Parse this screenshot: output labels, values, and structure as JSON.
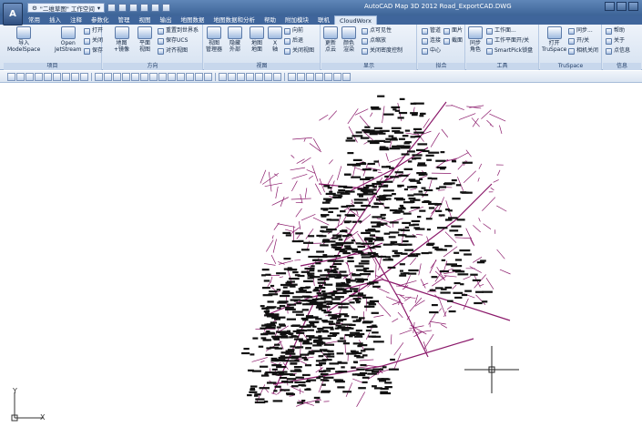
{
  "window": {
    "title": "AutoCAD Map 3D 2012    Road_ExportCAD.DWG",
    "workspace": "\"二维草图\" 工作空间"
  },
  "tabs": [
    "常用",
    "插入",
    "注释",
    "参数化",
    "管理",
    "视图",
    "输出",
    "地图数据",
    "地图数据和分析",
    "帮助",
    "附加模块",
    "联机",
    "CloudWorx"
  ],
  "active_tab": "CloudWorx",
  "ribbon": {
    "project": {
      "title": "项目",
      "import_label": "导入\nModelSpace",
      "import_line1": "导入",
      "import_line2": "ModelSpace",
      "open_line1": "Open",
      "open_line2": "JetStream",
      "open_label": "打开",
      "close_label": "关闭",
      "save_label": "保存"
    },
    "orientation": {
      "title": "方向",
      "map_label": "地图\n+镜像",
      "map_line1": "地图",
      "map_line2": "+镜像",
      "plane_line1": "平面",
      "plane_line2": "视图",
      "reset_world": "重置到世界系",
      "save_ucs": "保存UCS",
      "align_view": "对齐视图"
    },
    "view": {
      "title": "视图",
      "view_mgr_line1": "视图",
      "view_mgr_line2": "管理器",
      "hide_line1": "隐藏",
      "hide_line2": "外部",
      "ground_line1": "地图",
      "ground_line2": "地面",
      "x_line1": "X",
      "x_line2": "轴",
      "forward": "向前",
      "backward": "后退",
      "close_view": "关闭视图"
    },
    "display": {
      "title": "显示",
      "update_line1": "更新",
      "update_line2": "点云",
      "color_line1": "颜色",
      "color_line2": "渲染",
      "limit_visible": "点可见性",
      "limit_box": "点缩放",
      "density_ctrl": "关闭密度控制"
    },
    "fit": {
      "title": "拟合",
      "pipe": "管道",
      "connect": "连接",
      "center": "中心",
      "face": "面片",
      "section": "截面"
    },
    "tools": {
      "title": "工具",
      "cyclone_line1": "同步",
      "cyclone_line2": "角色",
      "workplane": "工作面...",
      "workplane_toggle": "工作平面开/关",
      "smartpick": "SmartPick锁盘"
    },
    "truspace": {
      "title": "TruSpace",
      "open_line1": "打开",
      "open_line2": "TruSpace",
      "sync": "同步...",
      "toggle": "开/关",
      "camera_close": "相机关闭"
    },
    "info": {
      "title": "信息",
      "help": "帮助",
      "about": "关于",
      "point_info": "点信息"
    }
  },
  "canvas": {
    "ucs_y": "Y",
    "ucs_x": "X"
  },
  "colors": {
    "titlebar": "#3d6497",
    "road": "#8b1a6b",
    "labels": "#111111"
  }
}
